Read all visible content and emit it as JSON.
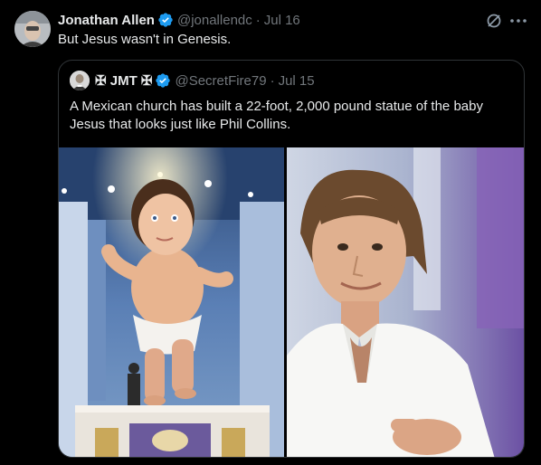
{
  "tweet": {
    "author_name": "Jonathan Allen",
    "handle": "@jonallendc",
    "separator": "·",
    "date": "Jul 16",
    "text": "But Jesus wasn't in Genesis."
  },
  "quote": {
    "author_name": "✠ JMT ✠",
    "handle": "@SecretFire79",
    "separator": "·",
    "date": "Jul 15",
    "text": "A Mexican church has built a 22-foot, 2,000 pound statue of the baby Jesus that looks just like Phil Collins."
  },
  "icons": {
    "verified": "verified-badge-icon",
    "grok": "grok-icon",
    "more": "more-icon"
  },
  "colors": {
    "background": "#000000",
    "text_primary": "#e7e9ea",
    "text_secondary": "#71767b",
    "verified_blue": "#1d9bf0",
    "border": "#2f3336"
  }
}
